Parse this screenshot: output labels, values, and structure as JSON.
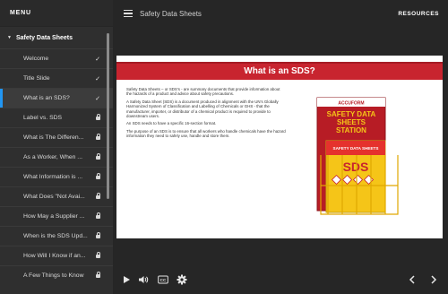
{
  "sidebar": {
    "header": "MENU",
    "section_title": "Safety Data Sheets",
    "items": [
      {
        "label": "Welcome",
        "status": "complete"
      },
      {
        "label": "Title Slide",
        "status": "complete"
      },
      {
        "label": "What is an SDS?",
        "status": "complete"
      },
      {
        "label": "Label vs. SDS",
        "status": "locked"
      },
      {
        "label": "What is The Differen...",
        "status": "locked"
      },
      {
        "label": "As a Worker, When ...",
        "status": "locked"
      },
      {
        "label": "What Information is ...",
        "status": "locked"
      },
      {
        "label": "What Does \"Not Avai...",
        "status": "locked"
      },
      {
        "label": "How May a Supplier ...",
        "status": "locked"
      },
      {
        "label": "When is the SDS Upd...",
        "status": "locked"
      },
      {
        "label": "How Will I Know if an...",
        "status": "locked"
      },
      {
        "label": "A Few Things to Know",
        "status": "locked"
      }
    ]
  },
  "topbar": {
    "course_title": "Safety Data Sheets",
    "resources_label": "RESOURCES"
  },
  "slide": {
    "title": "What is an SDS?",
    "paragraphs": [
      "Safety Data Sheets – or SDS's - are summary documents that provide information about the hazards of a product and advice about safety precautions.",
      "A Safety Data Sheet (SDS) is a document produced in alignment with the UN's Globally Harmonized System of Classification and Labelling of Chemicals or GHS - that the manufacturer, importer, or distributor of a chemical product is required to provide to downstream users.",
      "An SDS needs to have a specific 16-section format.",
      "The purpose of an SDS is to ensure that all workers who handle chemicals have the hazard information they need to safely use, handle and store them."
    ],
    "image": {
      "brand": "ACCUFORM",
      "sign_line1": "SAFETY DATA",
      "sign_line2": "SHEETS",
      "sign_line3": "STATION",
      "binder_title": "SAFETY DATA SHEETS",
      "binder_big": "SDS"
    }
  },
  "colors": {
    "accent": "#2196f3",
    "banner": "#c8242f",
    "sign_red": "#b71c25",
    "sign_yellow": "#f5c518"
  },
  "icons": {
    "play": "play-icon",
    "volume": "volume-icon",
    "captions": "cc-icon",
    "settings": "gear-icon",
    "prev": "chevron-left-icon",
    "next": "chevron-right-icon"
  },
  "controls": {
    "cc_label": "CC"
  }
}
